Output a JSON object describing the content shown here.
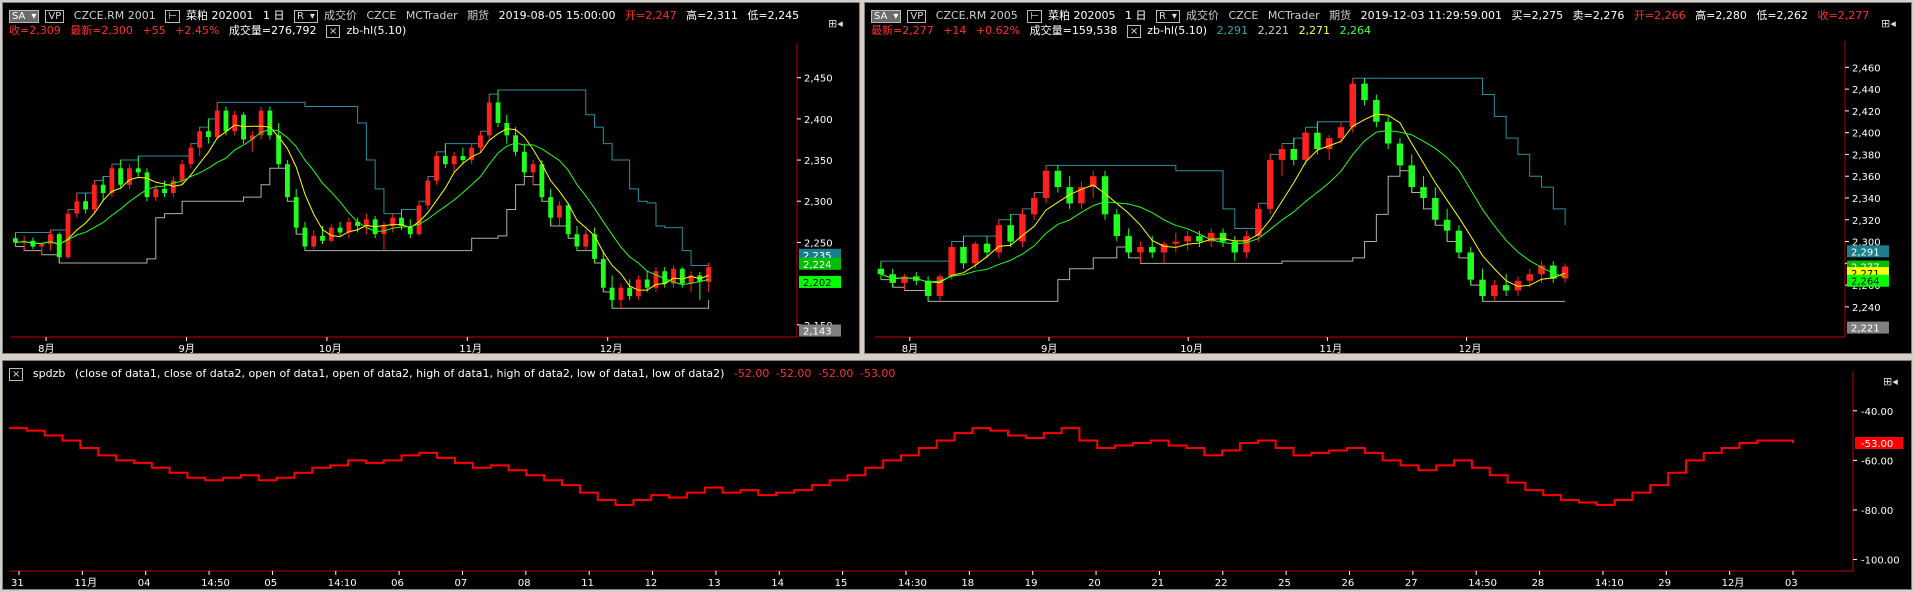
{
  "panel1": {
    "sa_label": "SA",
    "vp_label": "VP",
    "symbol": "CZCE.RM 2001",
    "name": "菜粕 202001",
    "interval": "1 日",
    "r_label": "R",
    "price_type": "成交价",
    "exchange": "CZCE",
    "source": "MCTrader",
    "market": "期货",
    "datetime": "2019-08-05 15:00:00",
    "open_text": "开=2,247",
    "high_text": "高=2,311",
    "low_text": "低=2,245",
    "close_text": "收=2,309",
    "last_text": "最新=2,300",
    "change_text": "+55",
    "pct_text": "+2.45%",
    "volume_text": "成交量=276,792",
    "indicator_label": "zb-hl(5.10)",
    "y_ticks": [
      "2,450",
      "2,400",
      "2,350",
      "2,300",
      "2,250",
      "2,150"
    ],
    "x_ticks": [
      "8月",
      "9月",
      "10月",
      "11月",
      "12月"
    ],
    "price_tags": [
      {
        "text": "2,235",
        "color": "#1a7f8c"
      },
      {
        "text": "2,224",
        "color": "#00c000"
      },
      {
        "text": "2,202",
        "color": "#00ff00"
      },
      {
        "text": "2,143",
        "color": "#808080"
      }
    ]
  },
  "panel2": {
    "sa_label": "SA",
    "vp_label": "VP",
    "symbol": "CZCE.RM 2005",
    "name": "菜粕 202005",
    "interval": "1 日",
    "r_label": "R",
    "price_type": "成交价",
    "exchange": "CZCE",
    "source": "MCTrader",
    "market": "期货",
    "datetime": "2019-12-03  11:29:59.001",
    "buy_text": "买=2,275",
    "sell_text": "卖=2,276",
    "open_text": "开=2,266",
    "high_text": "高=2,280",
    "low_text": "低=2,262",
    "close_text": "收=2,277",
    "last_text": "最新=2,277",
    "change_text": "+14",
    "pct_text": "+0.62%",
    "volume_text": "成交量=159,538",
    "indicator_label": "zb-hl(5.10)",
    "ind_vals": [
      "2,291",
      "2,221",
      "2,271",
      "2,264"
    ],
    "y_ticks": [
      "2,460",
      "2,440",
      "2,420",
      "2,400",
      "2,380",
      "2,360",
      "2,340",
      "2,320",
      "2,300",
      "2,280",
      "2,260",
      "2,240"
    ],
    "x_ticks": [
      "8月",
      "9月",
      "10月",
      "11月",
      "12月"
    ],
    "price_tags": [
      {
        "text": "2,291",
        "color": "#1a7f8c"
      },
      {
        "text": "2,277",
        "color": "#00c000"
      },
      {
        "text": "2,271",
        "color": "#ffff00"
      },
      {
        "text": "2,264",
        "color": "#00ff00"
      },
      {
        "text": "2,221",
        "color": "#808080"
      }
    ]
  },
  "panel3": {
    "indicator_name": "spdzb",
    "params": "(close of data1,  close of data2,  open of data1,  open of data2,  high of data1,  high of data2,  low of data1,  low of data2)",
    "values": [
      "-52.00",
      "-52.00",
      "-52.00",
      "-53.00"
    ],
    "y_ticks": [
      "-40.00",
      "-60.00",
      "-80.00",
      "-100.00"
    ],
    "current_tag": "-53.00",
    "x_ticks": [
      "31",
      "11月",
      "04",
      "14:50",
      "05",
      "14:10",
      "06",
      "07",
      "08",
      "11",
      "12",
      "13",
      "14",
      "15",
      "14:30",
      "18",
      "19",
      "20",
      "21",
      "22",
      "25",
      "26",
      "27",
      "14:50",
      "28",
      "14:10",
      "29",
      "12月",
      "03"
    ]
  },
  "chart_data": [
    {
      "type": "candlestick",
      "title": "CZCE.RM 2001",
      "ylim": [
        2140,
        2480
      ],
      "x_labels": [
        "8月",
        "9月",
        "10月",
        "11月",
        "12月"
      ],
      "y_ticks": [
        2450,
        2400,
        2350,
        2300,
        2250,
        2150
      ],
      "candles": [
        [
          2255,
          2262,
          2245,
          2250
        ],
        [
          2250,
          2258,
          2240,
          2252
        ],
        [
          2252,
          2256,
          2242,
          2245
        ],
        [
          2245,
          2250,
          2235,
          2248
        ],
        [
          2248,
          2265,
          2240,
          2260
        ],
        [
          2260,
          2262,
          2225,
          2232
        ],
        [
          2232,
          2290,
          2230,
          2285
        ],
        [
          2285,
          2310,
          2280,
          2300
        ],
        [
          2300,
          2310,
          2285,
          2290
        ],
        [
          2290,
          2325,
          2285,
          2320
        ],
        [
          2320,
          2330,
          2300,
          2310
        ],
        [
          2310,
          2345,
          2305,
          2340
        ],
        [
          2340,
          2350,
          2315,
          2320
        ],
        [
          2320,
          2345,
          2315,
          2340
        ],
        [
          2340,
          2355,
          2330,
          2335
        ],
        [
          2335,
          2340,
          2300,
          2305
        ],
        [
          2305,
          2320,
          2300,
          2315
        ],
        [
          2315,
          2325,
          2305,
          2310
        ],
        [
          2310,
          2330,
          2305,
          2325
        ],
        [
          2325,
          2350,
          2320,
          2345
        ],
        [
          2345,
          2370,
          2340,
          2365
        ],
        [
          2365,
          2390,
          2355,
          2385
        ],
        [
          2385,
          2400,
          2370,
          2378
        ],
        [
          2378,
          2420,
          2375,
          2410
        ],
        [
          2410,
          2415,
          2380,
          2385
        ],
        [
          2385,
          2410,
          2380,
          2405
        ],
        [
          2405,
          2408,
          2370,
          2375
        ],
        [
          2375,
          2385,
          2360,
          2380
        ],
        [
          2380,
          2415,
          2375,
          2410
        ],
        [
          2410,
          2415,
          2375,
          2380
        ],
        [
          2380,
          2395,
          2340,
          2345
        ],
        [
          2345,
          2350,
          2300,
          2305
        ],
        [
          2305,
          2315,
          2260,
          2268
        ],
        [
          2268,
          2275,
          2240,
          2245
        ],
        [
          2245,
          2265,
          2242,
          2258
        ],
        [
          2258,
          2270,
          2248,
          2252
        ],
        [
          2252,
          2272,
          2250,
          2268
        ],
        [
          2268,
          2275,
          2258,
          2262
        ],
        [
          2262,
          2280,
          2255,
          2275
        ],
        [
          2275,
          2280,
          2262,
          2270
        ],
        [
          2270,
          2285,
          2260,
          2278
        ],
        [
          2278,
          2282,
          2255,
          2260
        ],
        [
          2260,
          2275,
          2240,
          2270
        ],
        [
          2270,
          2285,
          2262,
          2280
        ],
        [
          2280,
          2290,
          2265,
          2270
        ],
        [
          2270,
          2278,
          2255,
          2260
        ],
        [
          2260,
          2300,
          2258,
          2295
        ],
        [
          2295,
          2330,
          2290,
          2325
        ],
        [
          2325,
          2360,
          2320,
          2355
        ],
        [
          2355,
          2370,
          2340,
          2345
        ],
        [
          2345,
          2360,
          2335,
          2355
        ],
        [
          2355,
          2365,
          2345,
          2350
        ],
        [
          2350,
          2370,
          2345,
          2365
        ],
        [
          2365,
          2385,
          2360,
          2380
        ],
        [
          2380,
          2430,
          2375,
          2420
        ],
        [
          2420,
          2435,
          2390,
          2395
        ],
        [
          2395,
          2405,
          2370,
          2380
        ],
        [
          2380,
          2390,
          2355,
          2360
        ],
        [
          2360,
          2370,
          2330,
          2335
        ],
        [
          2335,
          2350,
          2320,
          2345
        ],
        [
          2345,
          2350,
          2300,
          2305
        ],
        [
          2305,
          2315,
          2270,
          2280
        ],
        [
          2280,
          2300,
          2270,
          2295
        ],
        [
          2295,
          2298,
          2255,
          2260
        ],
        [
          2260,
          2270,
          2240,
          2245
        ],
        [
          2245,
          2265,
          2240,
          2260
        ],
        [
          2260,
          2268,
          2225,
          2230
        ],
        [
          2230,
          2240,
          2190,
          2195
        ],
        [
          2195,
          2210,
          2170,
          2180
        ],
        [
          2180,
          2200,
          2170,
          2195
        ],
        [
          2195,
          2205,
          2180,
          2185
        ],
        [
          2185,
          2210,
          2180,
          2205
        ],
        [
          2205,
          2215,
          2190,
          2195
        ],
        [
          2195,
          2220,
          2190,
          2215
        ],
        [
          2215,
          2220,
          2195,
          2200
        ],
        [
          2200,
          2222,
          2195,
          2218
        ],
        [
          2218,
          2220,
          2195,
          2200
        ],
        [
          2200,
          2215,
          2190,
          2210
        ],
        [
          2210,
          2214,
          2180,
          2202
        ],
        [
          2202,
          2225,
          2190,
          2220
        ]
      ],
      "series": [
        {
          "name": "upper",
          "color": "#2a8fa0"
        },
        {
          "name": "lower",
          "color": "#b0b0b0"
        },
        {
          "name": "ma_fast",
          "color": "#ffff00"
        },
        {
          "name": "ma_slow",
          "color": "#20ff20"
        }
      ]
    },
    {
      "type": "candlestick",
      "title": "CZCE.RM 2005",
      "ylim": [
        2216,
        2475
      ],
      "x_labels": [
        "8月",
        "9月",
        "10月",
        "11月",
        "12月"
      ],
      "y_ticks": [
        2460,
        2440,
        2420,
        2400,
        2380,
        2360,
        2340,
        2320,
        2300,
        2280,
        2260,
        2240
      ],
      "candles": [
        [
          2275,
          2282,
          2265,
          2270
        ],
        [
          2270,
          2275,
          2258,
          2262
        ],
        [
          2262,
          2270,
          2255,
          2268
        ],
        [
          2268,
          2272,
          2260,
          2264
        ],
        [
          2264,
          2268,
          2245,
          2250
        ],
        [
          2250,
          2270,
          2245,
          2268
        ],
        [
          2268,
          2300,
          2265,
          2295
        ],
        [
          2295,
          2305,
          2275,
          2280
        ],
        [
          2280,
          2300,
          2275,
          2298
        ],
        [
          2298,
          2305,
          2285,
          2290
        ],
        [
          2290,
          2320,
          2285,
          2315
        ],
        [
          2315,
          2325,
          2295,
          2300
        ],
        [
          2300,
          2330,
          2295,
          2325
        ],
        [
          2325,
          2345,
          2320,
          2340
        ],
        [
          2340,
          2370,
          2335,
          2365
        ],
        [
          2365,
          2370,
          2345,
          2350
        ],
        [
          2350,
          2360,
          2330,
          2335
        ],
        [
          2335,
          2355,
          2330,
          2350
        ],
        [
          2350,
          2365,
          2340,
          2360
        ],
        [
          2360,
          2365,
          2320,
          2325
        ],
        [
          2325,
          2330,
          2300,
          2305
        ],
        [
          2305,
          2312,
          2285,
          2290
        ],
        [
          2290,
          2300,
          2280,
          2295
        ],
        [
          2295,
          2305,
          2285,
          2290
        ],
        [
          2290,
          2300,
          2280,
          2298
        ],
        [
          2298,
          2308,
          2290,
          2300
        ],
        [
          2300,
          2310,
          2292,
          2305
        ],
        [
          2305,
          2310,
          2295,
          2300
        ],
        [
          2300,
          2312,
          2295,
          2308
        ],
        [
          2308,
          2312,
          2295,
          2300
        ],
        [
          2300,
          2305,
          2282,
          2290
        ],
        [
          2290,
          2310,
          2285,
          2305
        ],
        [
          2305,
          2335,
          2300,
          2330
        ],
        [
          2330,
          2380,
          2325,
          2375
        ],
        [
          2375,
          2390,
          2360,
          2385
        ],
        [
          2385,
          2395,
          2370,
          2375
        ],
        [
          2375,
          2405,
          2370,
          2400
        ],
        [
          2400,
          2410,
          2380,
          2385
        ],
        [
          2385,
          2398,
          2375,
          2395
        ],
        [
          2395,
          2410,
          2390,
          2405
        ],
        [
          2405,
          2450,
          2400,
          2445
        ],
        [
          2445,
          2450,
          2425,
          2430
        ],
        [
          2430,
          2435,
          2405,
          2410
        ],
        [
          2410,
          2415,
          2385,
          2390
        ],
        [
          2390,
          2395,
          2365,
          2370
        ],
        [
          2370,
          2380,
          2345,
          2350
        ],
        [
          2350,
          2360,
          2330,
          2340
        ],
        [
          2340,
          2350,
          2315,
          2320
        ],
        [
          2320,
          2330,
          2300,
          2310
        ],
        [
          2310,
          2315,
          2285,
          2290
        ],
        [
          2290,
          2295,
          2260,
          2265
        ],
        [
          2265,
          2275,
          2245,
          2250
        ],
        [
          2250,
          2265,
          2245,
          2260
        ],
        [
          2260,
          2270,
          2250,
          2255
        ],
        [
          2255,
          2268,
          2250,
          2264
        ],
        [
          2264,
          2275,
          2258,
          2270
        ],
        [
          2270,
          2282,
          2262,
          2278
        ],
        [
          2278,
          2282,
          2262,
          2266
        ],
        [
          2266,
          2280,
          2262,
          2277
        ]
      ],
      "series": [
        {
          "name": "upper",
          "color": "#2a8fa0"
        },
        {
          "name": "lower",
          "color": "#b0b0b0"
        },
        {
          "name": "ma_fast",
          "color": "#ffff00"
        },
        {
          "name": "ma_slow",
          "color": "#20ff20"
        }
      ]
    },
    {
      "type": "line",
      "title": "spdzb",
      "ylim": [
        -103,
        -28
      ],
      "y_ticks": [
        -40,
        -60,
        -80,
        -100
      ],
      "series": [
        {
          "name": "spdzb",
          "color": "#ff0000",
          "values": [
            -47,
            -48,
            -50,
            -52,
            -55,
            -58,
            -60,
            -61,
            -63,
            -65,
            -67,
            -68,
            -67,
            -66,
            -68,
            -67,
            -65,
            -63,
            -62,
            -60,
            -61,
            -60,
            -58,
            -57,
            -59,
            -61,
            -63,
            -62,
            -64,
            -66,
            -68,
            -70,
            -73,
            -76,
            -78,
            -76,
            -74,
            -75,
            -73,
            -71,
            -73,
            -72,
            -74,
            -73,
            -72,
            -70,
            -68,
            -66,
            -63,
            -60,
            -58,
            -55,
            -52,
            -49,
            -47,
            -48,
            -50,
            -51,
            -49,
            -47,
            -52,
            -55,
            -54,
            -53,
            -52,
            -54,
            -55,
            -58,
            -56,
            -53,
            -52,
            -55,
            -58,
            -57,
            -56,
            -55,
            -57,
            -60,
            -62,
            -64,
            -62,
            -60,
            -63,
            -66,
            -69,
            -72,
            -74,
            -76,
            -77,
            -78,
            -76,
            -73,
            -70,
            -65,
            -60,
            -57,
            -55,
            -53,
            -52,
            -52,
            -53
          ]
        }
      ]
    }
  ]
}
